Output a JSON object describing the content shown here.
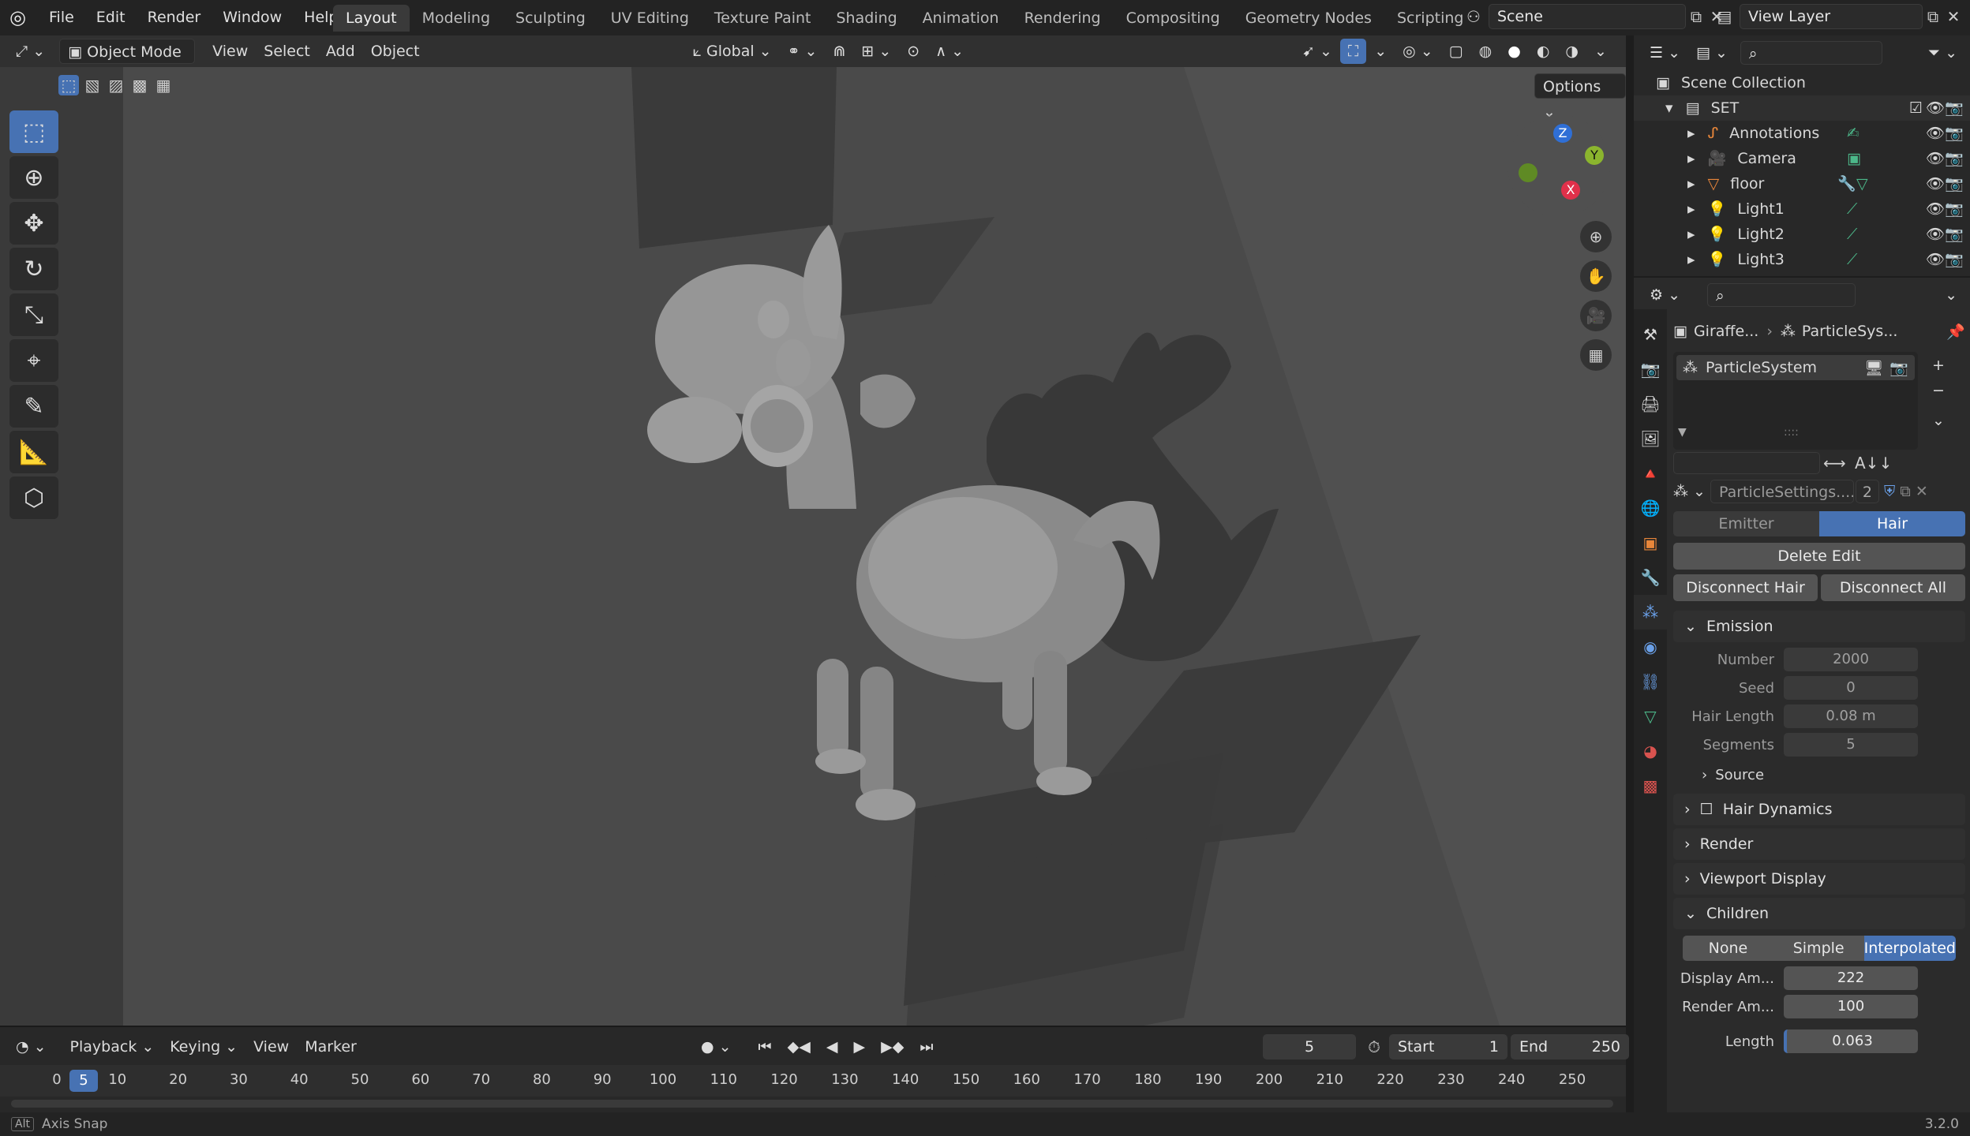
{
  "topbar": {
    "menus": [
      "File",
      "Edit",
      "Render",
      "Window",
      "Help"
    ],
    "workspaces": [
      "Layout",
      "Modeling",
      "Sculpting",
      "UV Editing",
      "Texture Paint",
      "Shading",
      "Animation",
      "Rendering",
      "Compositing",
      "Geometry Nodes",
      "Scripting"
    ],
    "active_workspace": "Layout",
    "scene_name": "Scene",
    "view_layer": "View Layer"
  },
  "viewport_header": {
    "mode": "Object Mode",
    "menus": [
      "View",
      "Select",
      "Add",
      "Object"
    ],
    "orientation": "Global",
    "options_label": "Options"
  },
  "gizmo": {
    "z": "Z",
    "y": "Y",
    "x": "X"
  },
  "outliner": {
    "root": "Scene Collection",
    "collection": "SET",
    "items": [
      "Annotations",
      "Camera",
      "floor",
      "Light1",
      "Light2",
      "Light3"
    ]
  },
  "properties": {
    "breadcrumb_object": "Giraffe...",
    "breadcrumb_particles": "ParticleSys...",
    "particle_system_name": "ParticleSystem",
    "settings_name": "ParticleSettings....",
    "settings_users": "2",
    "type_options": [
      "Emitter",
      "Hair"
    ],
    "active_type": "Hair",
    "delete_edit": "Delete Edit",
    "disconnect_hair": "Disconnect Hair",
    "disconnect_all": "Disconnect All",
    "emission": {
      "title": "Emission",
      "number_label": "Number",
      "number": "2000",
      "seed_label": "Seed",
      "seed": "0",
      "hair_length_label": "Hair Length",
      "hair_length": "0.08 m",
      "segments_label": "Segments",
      "segments": "5",
      "source_label": "Source"
    },
    "panels": [
      "Hair Dynamics",
      "Render",
      "Viewport Display"
    ],
    "children": {
      "title": "Children",
      "options": [
        "None",
        "Simple",
        "Interpolated"
      ],
      "active": "Interpolated",
      "display_amount_label": "Display Am...",
      "display_amount": "222",
      "render_amount_label": "Render Am...",
      "render_amount": "100",
      "length_label": "Length",
      "length": "0.063"
    }
  },
  "timeline": {
    "menus": [
      "Playback",
      "Keying",
      "View",
      "Marker"
    ],
    "current_frame": "5",
    "start_label": "Start",
    "start": "1",
    "end_label": "End",
    "end": "250",
    "ticks": [
      "0",
      "10",
      "20",
      "30",
      "40",
      "50",
      "60",
      "70",
      "80",
      "90",
      "100",
      "110",
      "120",
      "130",
      "140",
      "150",
      "160",
      "170",
      "180",
      "190",
      "200",
      "210",
      "220",
      "230",
      "240",
      "250"
    ]
  },
  "status": {
    "key": "Alt",
    "hint": "Axis Snap",
    "version": "3.2.0"
  }
}
